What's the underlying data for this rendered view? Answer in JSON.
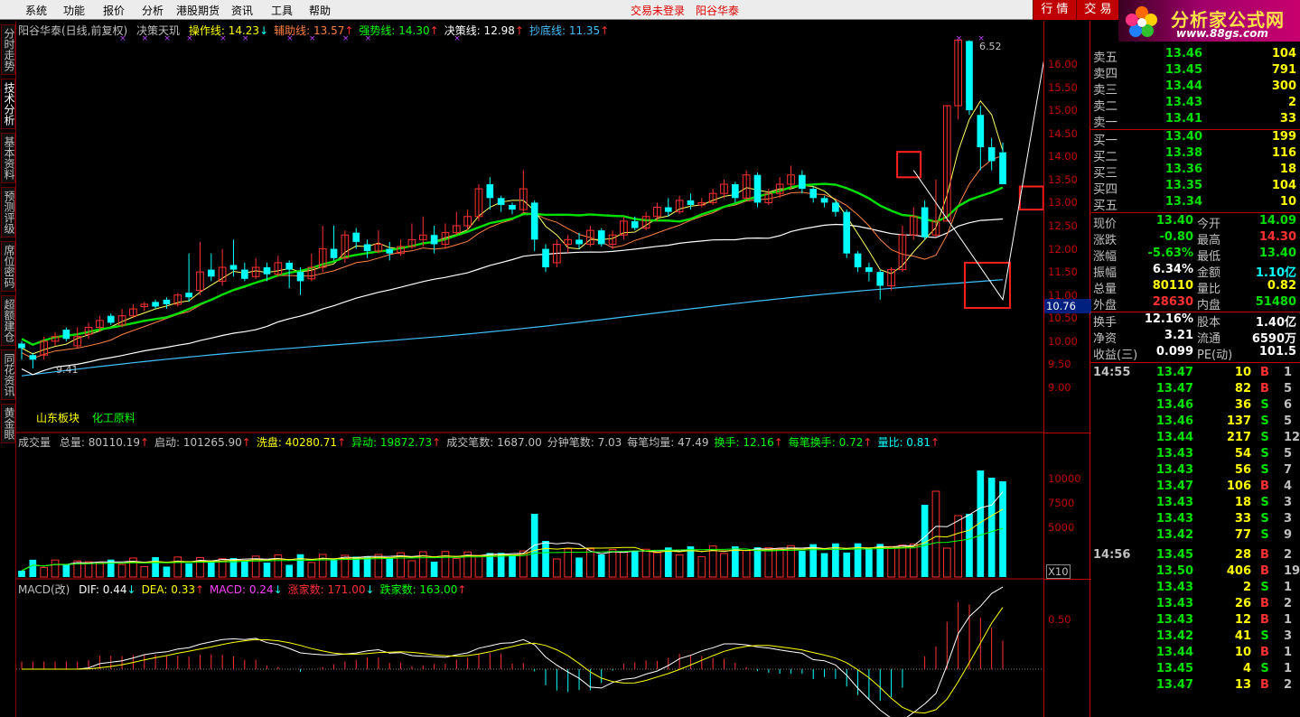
{
  "menu": {
    "items": [
      "系统",
      "功能",
      "报价",
      "分析",
      "港股期货",
      "资讯",
      "工具",
      "帮助"
    ],
    "status": "交易未登录",
    "stock": "阳谷华泰",
    "btn_quote": "行 情",
    "btn_trade": "交 易"
  },
  "logo": {
    "title": "分析家公式网",
    "url": "www.88gs.com"
  },
  "left_tabs": [
    "分时走势",
    "技术分析",
    "基本资料",
    "预测评级",
    "席位密码",
    "超额建仓",
    "同花资讯",
    "黄金眼"
  ],
  "main_header": {
    "name": "阳谷华泰(日线,前复权)",
    "indicator": "决策天玑",
    "items": [
      {
        "label": "操作线: 14.23",
        "arrow": "↓",
        "color": "#ffff00",
        "arrow_color": "#00ffff"
      },
      {
        "label": "辅助线: 13.57",
        "arrow": "↑",
        "color": "#ff8040",
        "arrow_color": "#ff3030"
      },
      {
        "label": "强势线: 14.30",
        "arrow": "↑",
        "color": "#00ff00",
        "arrow_color": "#ff3030"
      },
      {
        "label": "决策线: 12.98",
        "arrow": "↑",
        "color": "#ffffff",
        "arrow_color": "#ff3030"
      },
      {
        "label": "抄底线: 11.35",
        "arrow": "↑",
        "color": "#40c0ff",
        "arrow_color": "#ff3030"
      }
    ],
    "annot_high": "6.52",
    "annot_low": "9.41",
    "sector_label": "山东板块",
    "industry_label": "化工原料"
  },
  "volume_header": {
    "name": "成交量",
    "items": [
      {
        "label": "总量: 80110.19",
        "arrow": "↑",
        "color": "#c0c0c0"
      },
      {
        "label": "启动: 101265.90",
        "arrow": "↑",
        "color": "#c0c0c0"
      },
      {
        "label": "洗盘: 40280.71",
        "arrow": "↑",
        "color": "#ffff00"
      },
      {
        "label": "异动: 19872.73",
        "arrow": "↑",
        "color": "#00ff00"
      },
      {
        "label": "成交笔数: 1687.00",
        "arrow": "",
        "color": "#c0c0c0"
      },
      {
        "label": "分钟笔数: 7.03",
        "arrow": "",
        "color": "#c0c0c0"
      },
      {
        "label": "每笔均量: 47.49",
        "arrow": "",
        "color": "#c0c0c0"
      },
      {
        "label": "换手: 12.16",
        "arrow": "↑",
        "color": "#00ff00"
      },
      {
        "label": "每笔换手: 0.72",
        "arrow": "↑",
        "color": "#00ff00"
      },
      {
        "label": "量比: 0.81",
        "arrow": "↑",
        "color": "#00ffff"
      }
    ]
  },
  "macd_header": {
    "name": "MACD(改)",
    "items": [
      {
        "label": "DIF: 0.44",
        "arrow": "↓",
        "color": "#ffffff",
        "arrow_color": "#00ffff"
      },
      {
        "label": "DEA: 0.33",
        "arrow": "↑",
        "color": "#ffff00",
        "arrow_color": "#ff3030"
      },
      {
        "label": "MACD: 0.24",
        "arrow": "↓",
        "color": "#ff40ff",
        "arrow_color": "#00ffff"
      },
      {
        "label": "涨家数: 171.00",
        "arrow": "↓",
        "color": "#ff3030",
        "arrow_color": "#00ffff"
      },
      {
        "label": "跌家数: 163.00",
        "arrow": "↑",
        "color": "#00ff00",
        "arrow_color": "#ff3030"
      }
    ]
  },
  "axis": {
    "price_ticks": [
      "16.00",
      "15.50",
      "15.00",
      "14.50",
      "14.00",
      "13.50",
      "13.00",
      "12.50",
      "12.00",
      "11.50",
      "11.00",
      "10.50",
      "10.00",
      "9.50",
      "9.00"
    ],
    "current_marker": "10.76",
    "volume_ticks": [
      "10000",
      "7500",
      "5000"
    ],
    "volume_unit": "X10",
    "macd_ticks": [
      "0.50"
    ]
  },
  "order_book": {
    "asks": [
      {
        "label": "卖五",
        "price": "13.46",
        "vol": "104"
      },
      {
        "label": "卖四",
        "price": "13.45",
        "vol": "791"
      },
      {
        "label": "卖三",
        "price": "13.44",
        "vol": "300"
      },
      {
        "label": "卖二",
        "price": "13.43",
        "vol": "2"
      },
      {
        "label": "卖一",
        "price": "13.41",
        "vol": "33"
      }
    ],
    "bids": [
      {
        "label": "买一",
        "price": "13.40",
        "vol": "199"
      },
      {
        "label": "买二",
        "price": "13.38",
        "vol": "116"
      },
      {
        "label": "买三",
        "price": "13.36",
        "vol": "18"
      },
      {
        "label": "买四",
        "price": "13.35",
        "vol": "104"
      },
      {
        "label": "买五",
        "price": "13.34",
        "vol": "10"
      }
    ]
  },
  "quote": [
    {
      "l1": "现价",
      "v1": "13.40",
      "c1": "green",
      "l2": "今开",
      "v2": "14.09",
      "c2": "green"
    },
    {
      "l1": "涨跌",
      "v1": "-0.80",
      "c1": "green",
      "l2": "最高",
      "v2": "14.30",
      "c2": "red"
    },
    {
      "l1": "涨幅",
      "v1": "-5.63%",
      "c1": "green",
      "l2": "最低",
      "v2": "13.40",
      "c2": "green"
    },
    {
      "l1": "振幅",
      "v1": "6.34%",
      "c1": "white",
      "l2": "金额",
      "v2": "1.10亿",
      "c2": "cyan"
    },
    {
      "l1": "总量",
      "v1": "80110",
      "c1": "yellow",
      "l2": "量比",
      "v2": "0.82",
      "c2": "yellow"
    },
    {
      "l1": "外盘",
      "v1": "28630",
      "c1": "red",
      "l2": "内盘",
      "v2": "51480",
      "c2": "green"
    },
    {
      "l1": "换手",
      "v1": "12.16%",
      "c1": "white",
      "l2": "股本",
      "v2": "1.40亿",
      "c2": "white"
    },
    {
      "l1": "净资",
      "v1": "3.21",
      "c1": "white",
      "l2": "流通",
      "v2": "6590万",
      "c2": "white"
    },
    {
      "l1": "收益(三)",
      "v1": "0.099",
      "c1": "white",
      "l2": "PE(动)",
      "v2": "101.5",
      "c2": "white"
    }
  ],
  "ticks": [
    {
      "time": "14:55",
      "price": "13.47",
      "vol": "10",
      "bs": "B",
      "n": "1"
    },
    {
      "time": "",
      "price": "13.47",
      "vol": "82",
      "bs": "B",
      "n": "5"
    },
    {
      "time": "",
      "price": "13.46",
      "vol": "36",
      "bs": "S",
      "n": "6"
    },
    {
      "time": "",
      "price": "13.46",
      "vol": "137",
      "bs": "S",
      "n": "5"
    },
    {
      "time": "",
      "price": "13.44",
      "vol": "217",
      "bs": "S",
      "n": "12"
    },
    {
      "time": "",
      "price": "13.43",
      "vol": "54",
      "bs": "S",
      "n": "5"
    },
    {
      "time": "",
      "price": "13.43",
      "vol": "56",
      "bs": "S",
      "n": "7"
    },
    {
      "time": "",
      "price": "13.47",
      "vol": "106",
      "bs": "B",
      "n": "4"
    },
    {
      "time": "",
      "price": "13.43",
      "vol": "18",
      "bs": "S",
      "n": "3"
    },
    {
      "time": "",
      "price": "13.43",
      "vol": "33",
      "bs": "S",
      "n": "3"
    },
    {
      "time": "",
      "price": "13.42",
      "vol": "77",
      "bs": "S",
      "n": "9"
    },
    {
      "time": "14:56",
      "price": "13.45",
      "vol": "28",
      "bs": "B",
      "n": "2"
    },
    {
      "time": "",
      "price": "13.50",
      "vol": "406",
      "bs": "B",
      "n": "19"
    },
    {
      "time": "",
      "price": "13.43",
      "vol": "2",
      "bs": "S",
      "n": "1"
    },
    {
      "time": "",
      "price": "13.43",
      "vol": "26",
      "bs": "B",
      "n": "2"
    },
    {
      "time": "",
      "price": "13.43",
      "vol": "12",
      "bs": "B",
      "n": "1"
    },
    {
      "time": "",
      "price": "13.42",
      "vol": "41",
      "bs": "S",
      "n": "3"
    },
    {
      "time": "",
      "price": "13.44",
      "vol": "10",
      "bs": "B",
      "n": "1"
    },
    {
      "time": "",
      "price": "13.45",
      "vol": "4",
      "bs": "S",
      "n": "1"
    },
    {
      "time": "",
      "price": "13.47",
      "vol": "13",
      "bs": "B",
      "n": "2"
    }
  ],
  "colors": {
    "up": "#ff3030",
    "down": "#00ffff",
    "strong_line": "#00e000",
    "assist_line": "#ff8040",
    "decision_line": "#ffffff",
    "bottom_line": "#40c0ff",
    "grid": "#c00000"
  },
  "chart_data": {
    "type": "candlestick",
    "price_range": [
      9.0,
      16.0
    ],
    "candles": [
      {
        "o": 9.95,
        "c": 9.85,
        "h": 10.0,
        "l": 9.6
      },
      {
        "o": 9.7,
        "c": 9.6,
        "h": 9.75,
        "l": 9.41
      },
      {
        "o": 9.7,
        "c": 10.0,
        "h": 10.1,
        "l": 9.6
      },
      {
        "o": 10.0,
        "c": 10.1,
        "h": 10.2,
        "l": 9.9
      },
      {
        "o": 10.25,
        "c": 10.05,
        "h": 10.3,
        "l": 10.0
      },
      {
        "o": 9.9,
        "c": 10.1,
        "h": 10.3,
        "l": 9.85
      },
      {
        "o": 10.15,
        "c": 10.3,
        "h": 10.4,
        "l": 10.05
      },
      {
        "o": 10.3,
        "c": 10.45,
        "h": 10.55,
        "l": 10.2
      },
      {
        "o": 10.55,
        "c": 10.4,
        "h": 10.6,
        "l": 10.35
      },
      {
        "o": 10.35,
        "c": 10.55,
        "h": 10.7,
        "l": 10.3
      },
      {
        "o": 10.55,
        "c": 10.7,
        "h": 10.8,
        "l": 10.5
      },
      {
        "o": 10.75,
        "c": 10.8,
        "h": 10.85,
        "l": 10.65
      },
      {
        "o": 10.85,
        "c": 10.75,
        "h": 10.9,
        "l": 10.7
      },
      {
        "o": 10.9,
        "c": 10.8,
        "h": 10.95,
        "l": 10.7
      },
      {
        "o": 10.8,
        "c": 11.0,
        "h": 11.05,
        "l": 10.75
      },
      {
        "o": 11.05,
        "c": 10.95,
        "h": 11.9,
        "l": 10.85
      },
      {
        "o": 11.1,
        "c": 11.5,
        "h": 12.15,
        "l": 11.0
      },
      {
        "o": 11.55,
        "c": 11.4,
        "h": 11.9,
        "l": 11.3
      },
      {
        "o": 11.3,
        "c": 11.6,
        "h": 12.0,
        "l": 11.2
      },
      {
        "o": 11.65,
        "c": 11.55,
        "h": 12.2,
        "l": 11.4
      },
      {
        "o": 11.55,
        "c": 11.35,
        "h": 11.7,
        "l": 11.3
      },
      {
        "o": 11.4,
        "c": 11.6,
        "h": 11.8,
        "l": 11.35
      },
      {
        "o": 11.6,
        "c": 11.45,
        "h": 11.7,
        "l": 11.3
      },
      {
        "o": 11.45,
        "c": 11.7,
        "h": 11.85,
        "l": 11.4
      },
      {
        "o": 11.7,
        "c": 11.55,
        "h": 11.75,
        "l": 11.15
      },
      {
        "o": 11.5,
        "c": 11.3,
        "h": 11.6,
        "l": 11.0
      },
      {
        "o": 11.35,
        "c": 11.6,
        "h": 11.9,
        "l": 11.3
      },
      {
        "o": 11.6,
        "c": 12.0,
        "h": 12.5,
        "l": 11.5
      },
      {
        "o": 12.0,
        "c": 11.8,
        "h": 12.5,
        "l": 11.75
      },
      {
        "o": 11.8,
        "c": 12.3,
        "h": 12.4,
        "l": 11.7
      },
      {
        "o": 12.35,
        "c": 12.15,
        "h": 12.45,
        "l": 12.0
      },
      {
        "o": 12.1,
        "c": 11.95,
        "h": 12.2,
        "l": 11.8
      },
      {
        "o": 11.95,
        "c": 12.1,
        "h": 12.4,
        "l": 11.9
      },
      {
        "o": 12.0,
        "c": 11.9,
        "h": 12.15,
        "l": 11.75
      },
      {
        "o": 11.9,
        "c": 12.05,
        "h": 12.2,
        "l": 11.85
      },
      {
        "o": 12.05,
        "c": 12.2,
        "h": 12.55,
        "l": 12.0
      },
      {
        "o": 12.2,
        "c": 12.3,
        "h": 12.7,
        "l": 12.05
      },
      {
        "o": 12.3,
        "c": 12.1,
        "h": 12.5,
        "l": 11.9
      },
      {
        "o": 12.1,
        "c": 12.35,
        "h": 12.55,
        "l": 12.0
      },
      {
        "o": 12.35,
        "c": 12.5,
        "h": 12.8,
        "l": 12.3
      },
      {
        "o": 12.5,
        "c": 12.7,
        "h": 12.85,
        "l": 12.4
      },
      {
        "o": 12.7,
        "c": 13.3,
        "h": 13.4,
        "l": 12.6
      },
      {
        "o": 13.4,
        "c": 13.1,
        "h": 13.55,
        "l": 12.85
      },
      {
        "o": 13.1,
        "c": 12.95,
        "h": 13.15,
        "l": 12.8
      },
      {
        "o": 12.95,
        "c": 12.85,
        "h": 13.0,
        "l": 12.75
      },
      {
        "o": 12.85,
        "c": 13.3,
        "h": 13.7,
        "l": 12.8
      },
      {
        "o": 13.0,
        "c": 12.2,
        "h": 13.05,
        "l": 11.95
      },
      {
        "o": 12.0,
        "c": 11.6,
        "h": 12.1,
        "l": 11.5
      },
      {
        "o": 11.7,
        "c": 12.1,
        "h": 12.2,
        "l": 11.6
      },
      {
        "o": 12.1,
        "c": 12.2,
        "h": 12.3,
        "l": 11.9
      },
      {
        "o": 12.2,
        "c": 12.1,
        "h": 12.35,
        "l": 12.0
      },
      {
        "o": 12.1,
        "c": 12.4,
        "h": 12.5,
        "l": 12.05
      },
      {
        "o": 12.4,
        "c": 12.1,
        "h": 12.45,
        "l": 12.05
      },
      {
        "o": 12.1,
        "c": 12.3,
        "h": 12.4,
        "l": 12.0
      },
      {
        "o": 12.3,
        "c": 12.6,
        "h": 12.7,
        "l": 12.2
      },
      {
        "o": 12.6,
        "c": 12.45,
        "h": 12.7,
        "l": 12.4
      },
      {
        "o": 12.45,
        "c": 12.7,
        "h": 12.8,
        "l": 12.4
      },
      {
        "o": 12.7,
        "c": 12.9,
        "h": 13.0,
        "l": 12.6
      },
      {
        "o": 12.9,
        "c": 12.8,
        "h": 13.1,
        "l": 12.7
      },
      {
        "o": 12.8,
        "c": 13.05,
        "h": 13.15,
        "l": 12.75
      },
      {
        "o": 13.05,
        "c": 12.95,
        "h": 13.2,
        "l": 12.85
      },
      {
        "o": 12.95,
        "c": 13.0,
        "h": 13.1,
        "l": 12.9
      },
      {
        "o": 13.0,
        "c": 13.2,
        "h": 13.3,
        "l": 12.95
      },
      {
        "o": 13.2,
        "c": 13.4,
        "h": 13.5,
        "l": 13.1
      },
      {
        "o": 13.4,
        "c": 13.1,
        "h": 13.45,
        "l": 13.0
      },
      {
        "o": 13.1,
        "c": 13.6,
        "h": 13.7,
        "l": 13.05
      },
      {
        "o": 13.6,
        "c": 13.0,
        "h": 13.65,
        "l": 12.9
      },
      {
        "o": 13.0,
        "c": 13.2,
        "h": 13.3,
        "l": 12.95
      },
      {
        "o": 13.2,
        "c": 13.4,
        "h": 13.55,
        "l": 13.1
      },
      {
        "o": 13.4,
        "c": 13.6,
        "h": 13.8,
        "l": 13.3
      },
      {
        "o": 13.6,
        "c": 13.3,
        "h": 13.7,
        "l": 13.2
      },
      {
        "o": 13.3,
        "c": 13.1,
        "h": 13.35,
        "l": 13.0
      },
      {
        "o": 13.1,
        "c": 13.0,
        "h": 13.15,
        "l": 12.9
      },
      {
        "o": 13.0,
        "c": 12.8,
        "h": 13.05,
        "l": 12.7
      },
      {
        "o": 12.8,
        "c": 11.9,
        "h": 12.85,
        "l": 11.8
      },
      {
        "o": 11.9,
        "c": 11.6,
        "h": 11.95,
        "l": 11.5
      },
      {
        "o": 11.6,
        "c": 11.5,
        "h": 11.7,
        "l": 11.3
      },
      {
        "o": 11.5,
        "c": 11.2,
        "h": 11.55,
        "l": 10.9
      },
      {
        "o": 11.2,
        "c": 11.55,
        "h": 11.6,
        "l": 11.1
      },
      {
        "o": 11.55,
        "c": 12.3,
        "h": 12.5,
        "l": 11.5
      },
      {
        "o": 12.3,
        "c": 12.7,
        "h": 12.9,
        "l": 12.2
      },
      {
        "o": 12.9,
        "c": 12.25,
        "h": 13.05,
        "l": 12.2
      },
      {
        "o": 12.3,
        "c": 12.6,
        "h": 13.5,
        "l": 12.25
      },
      {
        "o": 12.6,
        "c": 15.1,
        "h": 15.1,
        "l": 12.6
      },
      {
        "o": 15.1,
        "c": 16.52,
        "h": 16.52,
        "l": 14.8
      },
      {
        "o": 16.5,
        "c": 15.0,
        "h": 16.52,
        "l": 14.9
      },
      {
        "o": 14.9,
        "c": 14.2,
        "h": 15.1,
        "l": 13.7
      },
      {
        "o": 14.2,
        "c": 13.9,
        "h": 14.4,
        "l": 13.7
      },
      {
        "o": 14.09,
        "c": 13.4,
        "h": 14.3,
        "l": 13.4
      }
    ],
    "volume_range": [
      0,
      14000
    ],
    "macd_range": [
      -0.6,
      0.9
    ]
  }
}
